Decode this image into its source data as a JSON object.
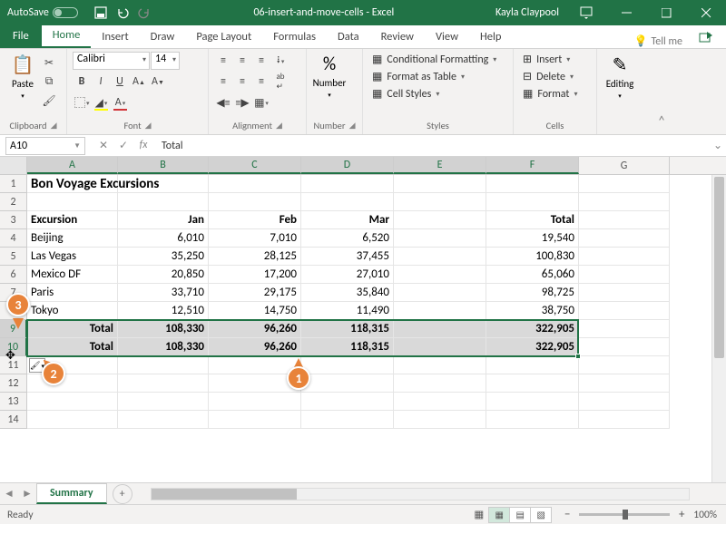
{
  "titlebar": {
    "autosave_label": "AutoSave",
    "app_title": "06-insert-and-move-cells - Excel",
    "user_name": "Kayla Claypool"
  },
  "tabs": {
    "file": "File",
    "items": [
      "Home",
      "Insert",
      "Draw",
      "Page Layout",
      "Formulas",
      "Data",
      "Review",
      "View",
      "Help"
    ],
    "active": "Home",
    "tell_me": "Tell me"
  },
  "ribbon": {
    "clipboard": {
      "label": "Clipboard",
      "paste": "Paste"
    },
    "font": {
      "label": "Font",
      "name": "Calibri",
      "size": "14"
    },
    "alignment": {
      "label": "Alignment"
    },
    "number": {
      "label": "Number",
      "btn": "Number"
    },
    "styles": {
      "label": "Styles",
      "cond": "Conditional Formatting",
      "table": "Format as Table",
      "cell": "Cell Styles"
    },
    "cells": {
      "label": "Cells",
      "insert": "Insert",
      "delete": "Delete",
      "format": "Format"
    },
    "editing": {
      "label": "Editing"
    }
  },
  "formulabar": {
    "name": "A10",
    "value": "Total"
  },
  "columns": [
    "A",
    "B",
    "C",
    "D",
    "E",
    "F",
    "G"
  ],
  "col_sel": [
    "A",
    "B",
    "C",
    "D",
    "E",
    "F"
  ],
  "rows_sel": [
    9,
    10
  ],
  "sheet": {
    "title": "Bon Voyage Excursions",
    "headers": {
      "A": "Excursion",
      "B": "Jan",
      "C": "Feb",
      "D": "Mar",
      "E": "",
      "F": "Total"
    },
    "data": [
      {
        "A": "Beijing",
        "B": "6,010",
        "C": "7,010",
        "D": "6,520",
        "F": "19,540"
      },
      {
        "A": "Las Vegas",
        "B": "35,250",
        "C": "28,125",
        "D": "37,455",
        "F": "100,830"
      },
      {
        "A": "Mexico DF",
        "B": "20,850",
        "C": "17,200",
        "D": "27,010",
        "F": "65,060"
      },
      {
        "A": "Paris",
        "B": "33,710",
        "C": "29,175",
        "D": "35,840",
        "F": "98,725"
      },
      {
        "A": "Tokyo",
        "B": "12,510",
        "C": "14,750",
        "D": "11,490",
        "F": "38,750"
      }
    ],
    "totals": [
      {
        "A": "Total",
        "B": "108,330",
        "C": "96,260",
        "D": "118,315",
        "F": "322,905"
      },
      {
        "A": "Total",
        "B": "108,330",
        "C": "96,260",
        "D": "118,315",
        "F": "322,905"
      }
    ]
  },
  "callouts": {
    "c1": "1",
    "c2": "2",
    "c3": "3"
  },
  "sheet_tabs": {
    "active": "Summary"
  },
  "statusbar": {
    "ready": "Ready",
    "zoom": "100%"
  }
}
